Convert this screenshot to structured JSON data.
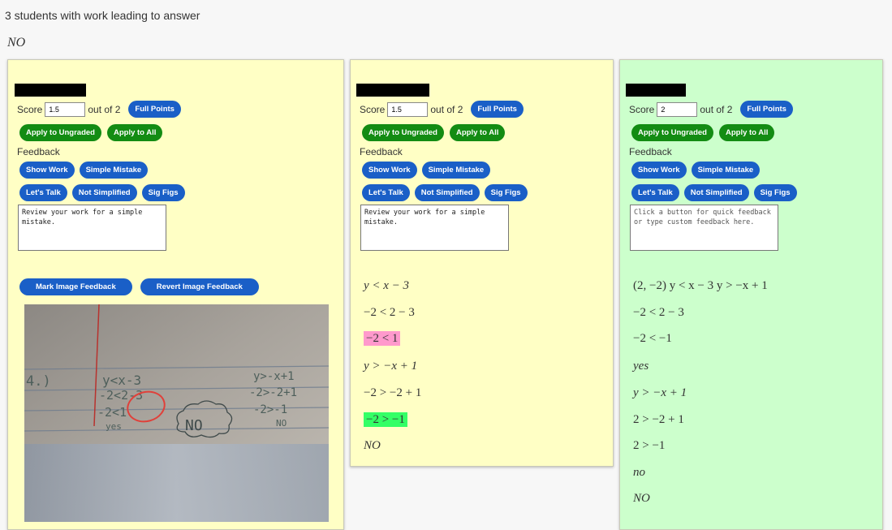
{
  "header": {
    "title": "3 students with work leading to answer",
    "answer": "NO"
  },
  "labels": {
    "score": "Score",
    "out_of": "out of 2",
    "full_points": "Full Points",
    "apply_ungraded": "Apply to Ungraded",
    "apply_all": "Apply to All",
    "feedback": "Feedback",
    "show_work": "Show Work",
    "simple_mistake": "Simple Mistake",
    "lets_talk": "Let's Talk",
    "not_simplified": "Not Simplified",
    "sig_figs": "Sig Figs",
    "mark_image": "Mark Image Feedback",
    "revert_image": "Revert Image Feedback",
    "placeholder": "Click a button for quick feedback or type custom feedback here."
  },
  "students": [
    {
      "score": "1.5",
      "feedback": "Review your work for a simple mistake.",
      "color": "#ffffc5"
    },
    {
      "score": "1.5",
      "feedback": "Review your work for a simple mistake.",
      "color": "#ffffc5",
      "work": [
        "y < x − 3",
        "−2 < 2 − 3",
        "−2 < 1",
        "y > −x + 1",
        "−2 > −2 + 1",
        "−2 > −1",
        "NO"
      ]
    },
    {
      "score": "2",
      "feedback": "",
      "color": "#ccffcc",
      "work": [
        "(2, −2)  y < x − 3   y > −x + 1",
        "−2 < 2 − 3",
        "−2 < −1",
        "yes",
        "y > −x + 1",
        "2 > −2 + 1",
        "2 > −1",
        "no",
        "NO"
      ]
    }
  ],
  "photo": {
    "label": "4.)",
    "left_lines": [
      "y<x-3",
      "-2<2-3",
      "-2<1",
      "yes"
    ],
    "right_lines": [
      "y>-x+1",
      "-2>-2+1",
      "-2>-1",
      "NO"
    ],
    "bubble": "NO"
  }
}
